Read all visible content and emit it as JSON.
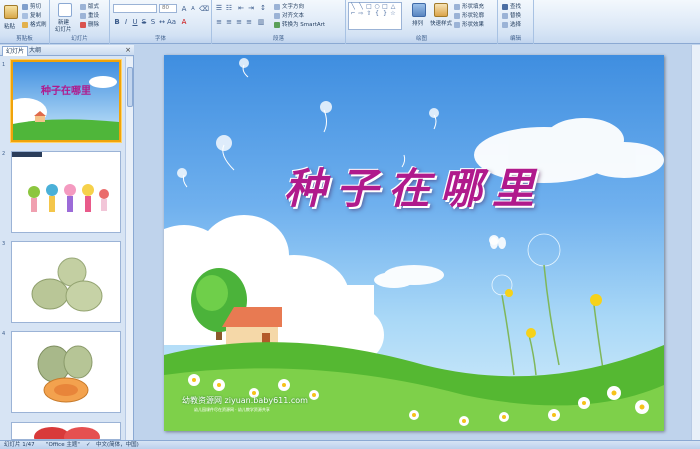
{
  "ribbon": {
    "clipboard": {
      "paste": "粘贴",
      "cut": "剪切",
      "copy": "复制",
      "format_painter": "格式刷",
      "label": "剪贴板"
    },
    "slides": {
      "new_slide": "新建",
      "new_slide_line2": "幻灯片",
      "layout": "版式",
      "reset": "重设",
      "delete": "删除",
      "label": "幻灯片"
    },
    "font": {
      "font_size": "80",
      "label": "字体"
    },
    "paragraph": {
      "text_direction": "文字方向",
      "align_text": "对齐文本",
      "convert_smartart": "转换为 SmartArt",
      "label": "段落"
    },
    "drawing": {
      "arrange": "排列",
      "quick_styles": "快速样式",
      "shape_fill": "形状填充",
      "shape_outline": "形状轮廓",
      "shape_effects": "形状效果",
      "label": "绘图"
    },
    "editing": {
      "find": "查找",
      "replace": "替换",
      "select": "选择",
      "label": "编辑"
    }
  },
  "left_pane": {
    "tab_slides": "幻灯片",
    "tab_outline": "大纲",
    "close": "×",
    "slide_numbers": [
      "1",
      "2",
      "3",
      "4"
    ]
  },
  "slide": {
    "title": "种子在哪里",
    "watermark": "幼教资源网 ziyuan.baby611.com",
    "watermark_sub": "幼儿园课件尽在资源网 · 幼儿教学资源共享"
  },
  "status_bar": {
    "slide_info": "幻灯片 1/47",
    "theme": "\"Office 主题\"",
    "language": "中文(简体，中国)"
  }
}
